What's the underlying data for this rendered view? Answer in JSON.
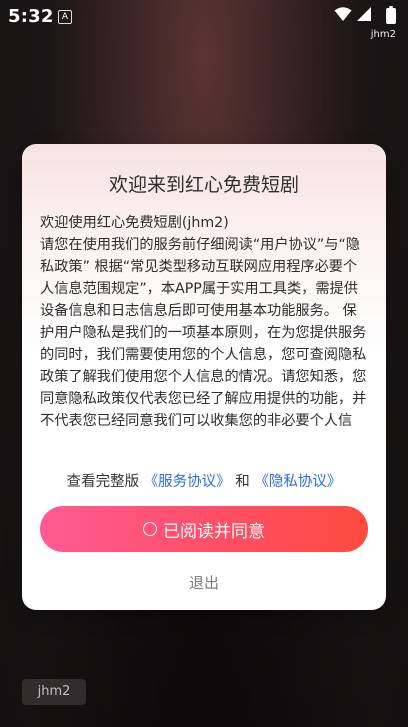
{
  "status_bar": {
    "time": "5:32",
    "app_badge": "A",
    "user_label": "jhm2"
  },
  "dialog": {
    "title": "欢迎来到红心免费短剧",
    "paragraphs": [
      "欢迎使用红心免费短剧(jhm2)",
      "请您在使用我们的服务前仔细阅读“用户协议”与“隐私政策” 根据“常见类型移动互联网应用程序必要个人信息范围规定”，本APP属于实用工具类，需提供设备信息和日志信息后即可使用基本功能服务。 保护用户隐私是我们的一项基本原则，在为您提供服务的同时，我们需要使用您的个人信息，您可查阅隐私政策了解我们使用您个人信息的情况。请您知悉，您同意隐私政策仅代表您已经了解应用提供的功能，并不代表您已经同意我们可以收集您的非必要个人信息，非"
    ],
    "links_prefix": "查看完整版",
    "service_link": "《服务协议》",
    "links_and": "和",
    "privacy_link": "《隐私协议》",
    "agree_label": "已阅读并同意",
    "exit_label": "退出"
  },
  "watermark": "jhm2",
  "colors": {
    "accent_start": "#ff5a93",
    "accent_end": "#ff4a3f",
    "link": "#2f6de0"
  }
}
